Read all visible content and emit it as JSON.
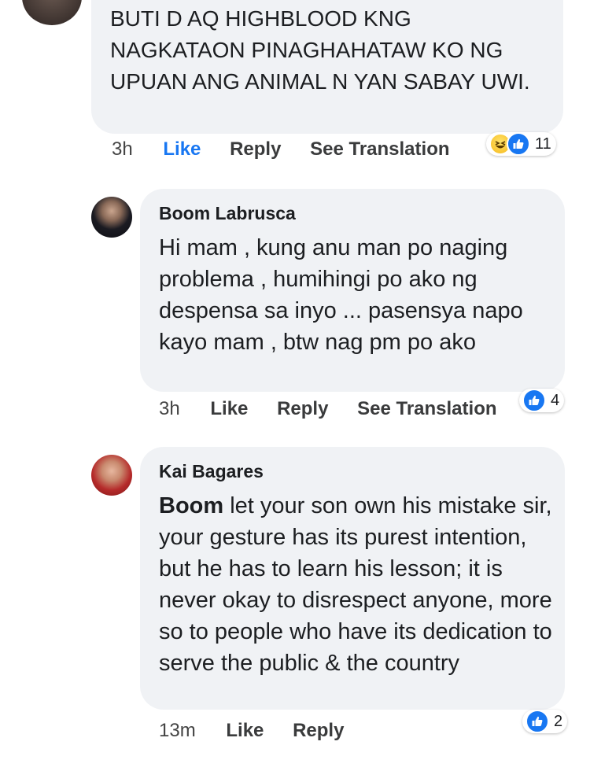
{
  "comments": [
    {
      "author": "",
      "text": "BUTI D AQ HIGHBLOOD KNG NAGKATAON PINAGHAHATAW KO NG UPUAN ANG ANIMAL N YAN SABAY UWI.",
      "time": "3h",
      "like": "Like",
      "reply": "Reply",
      "translate": "See Translation",
      "reactions": [
        "haha-icon",
        "like-icon"
      ],
      "reaction_count": "11"
    },
    {
      "author": "Boom Labrusca",
      "text": "Hi mam , kung anu man po naging problema , humihingi po ako ng despensa sa inyo ... pasensya napo kayo mam , btw nag pm po ako",
      "time": "3h",
      "like": "Like",
      "reply": "Reply",
      "translate": "See Translation",
      "reactions": [
        "like-icon"
      ],
      "reaction_count": "4"
    },
    {
      "author": "Kai Bagares",
      "mention": "Boom",
      "text": " let your son own his mistake sir, your gesture has its purest intention, but he has to learn his lesson; it is never okay to disrespect anyone, more so to people who have its dedication to serve the public & the country",
      "time": "13m",
      "like": "Like",
      "reply": "Reply",
      "reactions": [
        "like-icon"
      ],
      "reaction_count": "2"
    }
  ],
  "colors": {
    "bubble": "#f0f2f5",
    "like_blue": "#1877f2",
    "text": "#1c1e21"
  }
}
